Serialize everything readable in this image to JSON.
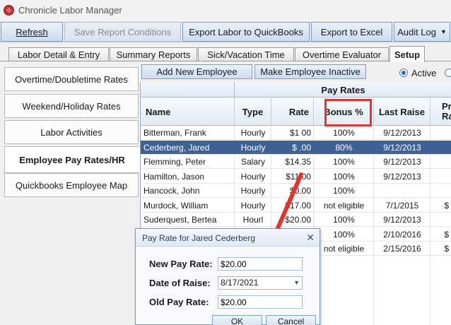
{
  "window": {
    "title": "Chronicle Labor Manager"
  },
  "toolbar": {
    "refresh": "Refresh",
    "save_report_conditions": "Save Report Conditions",
    "export_quickbooks": "Export Labor to QuickBooks",
    "export_excel": "Export to Excel",
    "audit_log": "Audit Log"
  },
  "tabs": [
    {
      "label": "Labor Detail & Entry"
    },
    {
      "label": "Summary Reports"
    },
    {
      "label": "Sick/Vacation Time"
    },
    {
      "label": "Overtime Evaluator"
    },
    {
      "label": "Setup"
    }
  ],
  "sidebar": {
    "items": [
      {
        "label": "Overtime/Doubletime Rates"
      },
      {
        "label": "Weekend/Holiday Rates"
      },
      {
        "label": "Labor Activities"
      },
      {
        "label": "Employee Pay Rates/HR"
      },
      {
        "label": "Quickbooks Employee Map"
      }
    ]
  },
  "actions": {
    "add_employee": "Add New Employee",
    "make_inactive": "Make Employee Inactive",
    "active_label": "Active"
  },
  "grid": {
    "band_title": "Pay Rates",
    "columns": {
      "name": "Name",
      "type": "Type",
      "rate": "Rate",
      "bonus": "Bonus %",
      "last_raise": "Last Raise",
      "extra": "Pr\nRa"
    },
    "rows": [
      {
        "name": "Bitterman, Frank",
        "type": "Hourly",
        "rate": "$1  00",
        "bonus": "100%",
        "last_raise": "9/12/2013",
        "extra": ""
      },
      {
        "name": "Cederberg, Jared",
        "type": "Hourly",
        "rate": "$  .00",
        "bonus": "80%",
        "last_raise": "9/12/2013",
        "extra": ""
      },
      {
        "name": "Flemming, Peter",
        "type": "Salary",
        "rate": "$14.35",
        "bonus": "100%",
        "last_raise": "9/12/2013",
        "extra": ""
      },
      {
        "name": "Hamilton, Jason",
        "type": "Hourly",
        "rate": "$11.00",
        "bonus": "100%",
        "last_raise": "9/12/2013",
        "extra": ""
      },
      {
        "name": "Hancock, John",
        "type": "Hourly",
        "rate": "$0.00",
        "bonus": "100%",
        "last_raise": "",
        "extra": ""
      },
      {
        "name": "Murdock, William",
        "type": "Hourly",
        "rate": "$17.00",
        "bonus": "not eligible",
        "last_raise": "7/1/2015",
        "extra": "$"
      },
      {
        "name": "Suderquest, Bertea",
        "type": "Hourl",
        "rate": "$20.00",
        "bonus": "100%",
        "last_raise": "9/12/2013",
        "extra": ""
      },
      {
        "name": "",
        "type": "",
        "rate": "",
        "bonus": "100%",
        "last_raise": "2/10/2016",
        "extra": "$"
      },
      {
        "name": "",
        "type": "",
        "rate": "",
        "bonus": "not eligible",
        "last_raise": "2/15/2016",
        "extra": "$"
      }
    ]
  },
  "dialog": {
    "title": "Pay Rate for Jared Cederberg",
    "new_pay_rate_label": "New Pay Rate:",
    "new_pay_rate_value": "$20.00",
    "date_of_raise_label": "Date of Raise:",
    "date_of_raise_value": "8/17/2021",
    "old_pay_rate_label": "Old Pay Rate:",
    "old_pay_rate_value": "$20.00",
    "ok": "OK",
    "cancel": "Cancel"
  },
  "colors": {
    "selected_row": "#3f6196",
    "highlight": "#e0342f",
    "arrow": "#e0342f"
  }
}
